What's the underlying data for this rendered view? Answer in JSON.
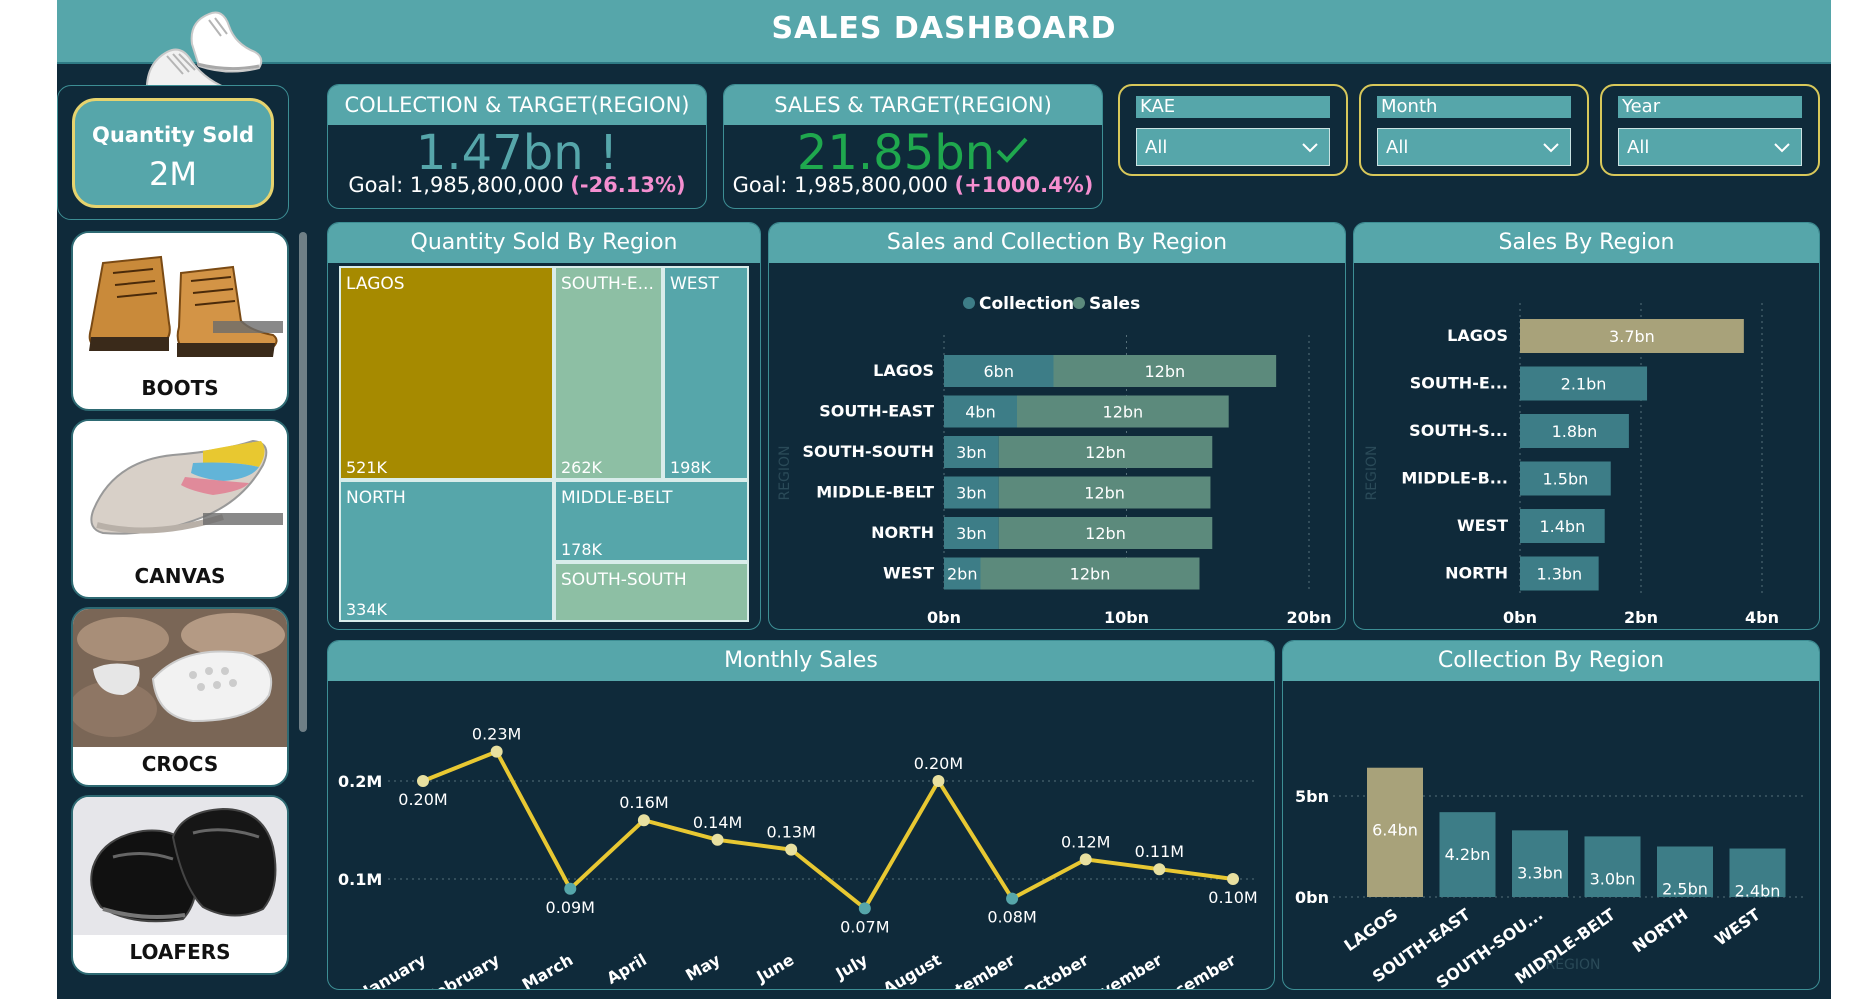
{
  "header": {
    "title": "SALES DASHBOARD"
  },
  "qty_card": {
    "label": "Quantity Sold",
    "value": "2M"
  },
  "products": [
    {
      "label": "BOOTS",
      "icon": "boots-photo"
    },
    {
      "label": "CANVAS",
      "icon": "canvas-sneaker-photo"
    },
    {
      "label": "CROCS",
      "icon": "crocs-photo"
    },
    {
      "label": "LOAFERS",
      "icon": "loafers-photo"
    }
  ],
  "kpi_collection": {
    "title": "COLLECTION & TARGET(REGION)",
    "value": "1.47bn !",
    "goal_text": "Goal: 1,985,800,000",
    "delta": "(-26.13%)",
    "value_color": "#56a6aa",
    "delta_color": "#f48fd0"
  },
  "kpi_sales": {
    "title": "SALES & TARGET(REGION)",
    "value": "21.85bn",
    "check_icon": "check-icon",
    "goal_text": "Goal: 1,985,800,000",
    "delta": "(+1000.4%)",
    "value_color": "#1fa84e",
    "delta_color": "#f48fd0"
  },
  "slicers": [
    {
      "label": "KAE",
      "value": "All"
    },
    {
      "label": "Month",
      "value": "All"
    },
    {
      "label": "Year",
      "value": "All"
    }
  ],
  "treemap": {
    "title": "Quantity Sold By Region",
    "chart_data": {
      "type": "treemap",
      "items": [
        {
          "name": "LAGOS",
          "value_label": "521K",
          "value": 521000,
          "color": "#a68a00"
        },
        {
          "name": "NORTH",
          "value_label": "334K",
          "value": 334000,
          "color": "#56a6aa"
        },
        {
          "name": "SOUTH-E...",
          "value_label": "262K",
          "value": 262000,
          "color": "#8dbfa4"
        },
        {
          "name": "WEST",
          "value_label": "198K",
          "value": 198000,
          "color": "#56a6aa"
        },
        {
          "name": "MIDDLE-BELT",
          "value_label": "178K",
          "value": 178000,
          "color": "#56a6aa"
        },
        {
          "name": "SOUTH-SOUTH",
          "value_label": "",
          "value": 150000,
          "color": "#8dbfa4"
        }
      ]
    }
  },
  "sales_collection": {
    "title": "Sales and Collection By Region",
    "legend": [
      {
        "name": "Collection",
        "color": "#3d7d87"
      },
      {
        "name": "Sales",
        "color": "#5c8a7c"
      }
    ],
    "yaxis_title": "REGION",
    "chart_data": {
      "type": "bar",
      "orientation": "horizontal",
      "stacked": true,
      "categories": [
        "LAGOS",
        "SOUTH-EAST",
        "SOUTH-SOUTH",
        "MIDDLE-BELT",
        "NORTH",
        "WEST"
      ],
      "series": [
        {
          "name": "Collection",
          "values": [
            6,
            4,
            3,
            3,
            3,
            2
          ],
          "labels": [
            "6bn",
            "4bn",
            "3bn",
            "3bn",
            "3bn",
            "2bn"
          ],
          "color": "#3d7d87"
        },
        {
          "name": "Sales",
          "values": [
            12.2,
            11.6,
            11.7,
            11.6,
            11.7,
            12.0
          ],
          "labels": [
            "12bn",
            "12bn",
            "12bn",
            "12bn",
            "12bn",
            "12bn"
          ],
          "color": "#5c8a7c"
        }
      ],
      "xticks": [
        "0bn",
        "10bn",
        "20bn"
      ],
      "xlim": [
        0,
        20
      ]
    }
  },
  "sales_region": {
    "title": "Sales By Region",
    "yaxis_title": "REGION",
    "chart_data": {
      "type": "bar",
      "orientation": "horizontal",
      "categories": [
        "LAGOS",
        "SOUTH-E...",
        "SOUTH-S...",
        "MIDDLE-B...",
        "WEST",
        "NORTH"
      ],
      "values": [
        3.7,
        2.1,
        1.8,
        1.5,
        1.4,
        1.3
      ],
      "labels": [
        "3.7bn",
        "2.1bn",
        "1.8bn",
        "1.5bn",
        "1.4bn",
        "1.3bn"
      ],
      "colors": [
        "#a8a27a",
        "#3d7d87",
        "#3d7d87",
        "#3d7d87",
        "#3d7d87",
        "#3d7d87"
      ],
      "xticks": [
        "0bn",
        "2bn",
        "4bn"
      ],
      "xlim": [
        0,
        4
      ]
    }
  },
  "monthly": {
    "title": "Monthly Sales",
    "chart_data": {
      "type": "line",
      "categories": [
        "January",
        "February",
        "March",
        "April",
        "May",
        "June",
        "July",
        "August",
        "September",
        "October",
        "November",
        "December"
      ],
      "values": [
        0.2,
        0.23,
        0.09,
        0.16,
        0.14,
        0.13,
        0.07,
        0.2,
        0.08,
        0.12,
        0.11,
        0.1
      ],
      "labels": [
        "0.20M",
        "0.23M",
        "0.09M",
        "0.16M",
        "0.14M",
        "0.13M",
        "0.07M",
        "0.20M",
        "0.08M",
        "0.12M",
        "0.11M",
        "0.10M"
      ],
      "yticks": [
        "0.1M",
        "0.2M"
      ],
      "line_color": "#e8c832",
      "marker_high": "#e8e0a0",
      "marker_low": "#56a6aa"
    }
  },
  "collection_region": {
    "title": "Collection By Region",
    "xaxis_title": "REGION",
    "chart_data": {
      "type": "bar",
      "categories": [
        "LAGOS",
        "SOUTH-EAST",
        "SOUTH-SOU...",
        "MIDDLE-BELT",
        "NORTH",
        "WEST"
      ],
      "values": [
        6.4,
        4.2,
        3.3,
        3.0,
        2.5,
        2.4
      ],
      "labels": [
        "6.4bn",
        "4.2bn",
        "3.3bn",
        "3.0bn",
        "2.5bn",
        "2.4bn"
      ],
      "colors": [
        "#a8a27a",
        "#3d7d87",
        "#3d7d87",
        "#3d7d87",
        "#3d7d87",
        "#3d7d87"
      ],
      "yticks": [
        "0bn",
        "5bn"
      ],
      "ylim": [
        0,
        6.4
      ]
    }
  }
}
